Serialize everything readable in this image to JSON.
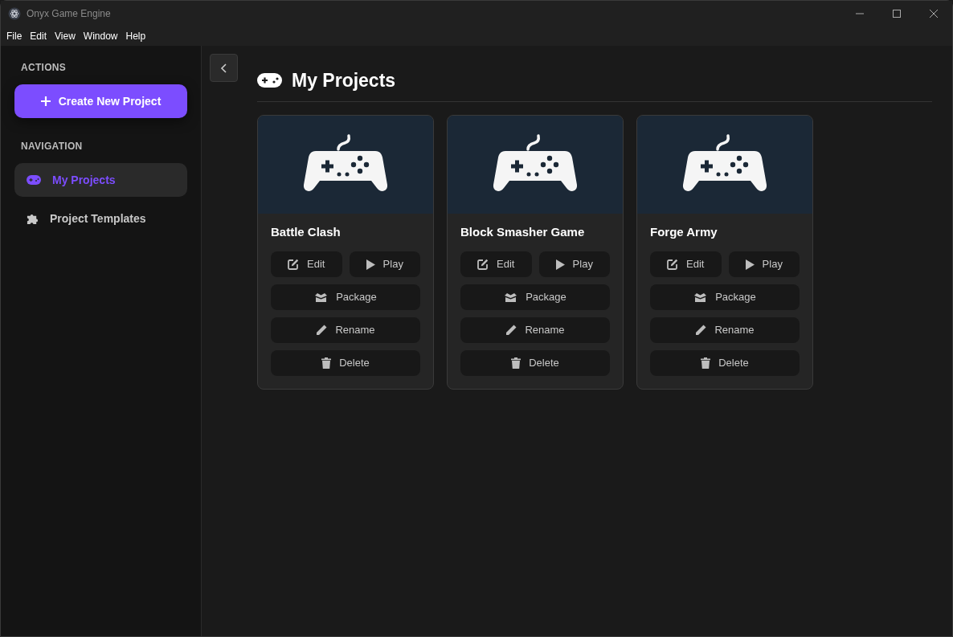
{
  "window": {
    "title": "Onyx Game Engine"
  },
  "menu": [
    "File",
    "Edit",
    "View",
    "Window",
    "Help"
  ],
  "sidebar": {
    "actions_heading": "ACTIONS",
    "create_button": "Create New Project",
    "navigation_heading": "NAVIGATION",
    "items": [
      {
        "label": "My Projects",
        "kind": "gamepad",
        "selected": true
      },
      {
        "label": "Project Templates",
        "kind": "puzzle",
        "selected": false
      }
    ]
  },
  "page": {
    "title": "My Projects",
    "projects": [
      {
        "name": "Battle Clash",
        "buttons": [
          {
            "label": "Edit",
            "kind": "edit"
          },
          {
            "label": "Play",
            "kind": "play"
          },
          {
            "label": "Package",
            "kind": "package"
          },
          {
            "label": "Rename",
            "kind": "rename"
          },
          {
            "label": "Delete",
            "kind": "delete"
          }
        ]
      },
      {
        "name": "Block Smasher Game",
        "buttons": [
          {
            "label": "Edit",
            "kind": "edit"
          },
          {
            "label": "Play",
            "kind": "play"
          },
          {
            "label": "Package",
            "kind": "package"
          },
          {
            "label": "Rename",
            "kind": "rename"
          },
          {
            "label": "Delete",
            "kind": "delete"
          }
        ]
      },
      {
        "name": "Forge Army",
        "buttons": [
          {
            "label": "Edit",
            "kind": "edit"
          },
          {
            "label": "Play",
            "kind": "play"
          },
          {
            "label": "Package",
            "kind": "package"
          },
          {
            "label": "Rename",
            "kind": "rename"
          },
          {
            "label": "Delete",
            "kind": "delete"
          }
        ]
      }
    ]
  }
}
